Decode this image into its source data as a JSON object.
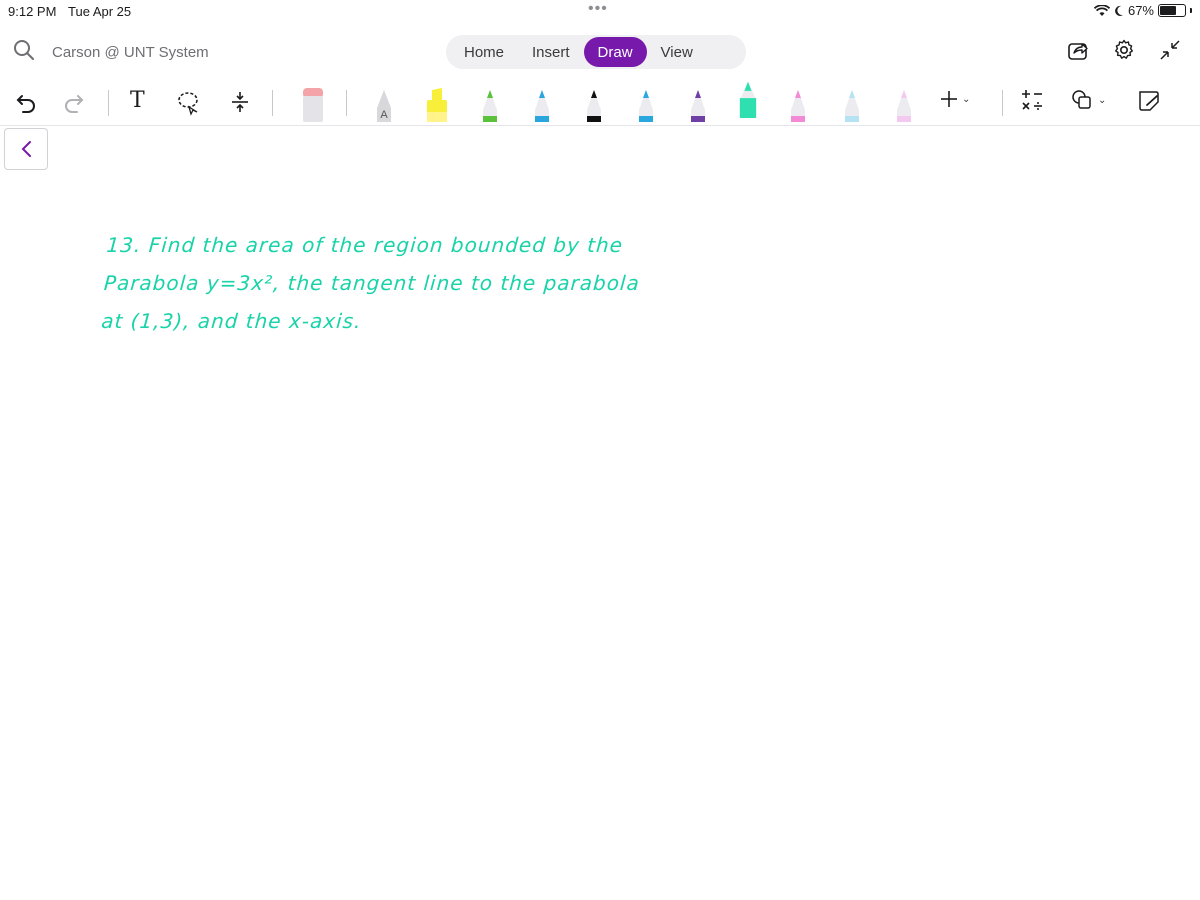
{
  "status": {
    "time": "9:12 PM",
    "date": "Tue Apr 25",
    "dots": "•••",
    "battery_label": "67%",
    "battery_level": 0.67
  },
  "header": {
    "account": "Carson @ UNT System",
    "tabs": [
      {
        "label": "Home",
        "active": false
      },
      {
        "label": "Insert",
        "active": false
      },
      {
        "label": "Draw",
        "active": true
      },
      {
        "label": "View",
        "active": false
      }
    ]
  },
  "toolbar": {
    "text_tool_label": "T",
    "pens": [
      {
        "name": "eraser",
        "color": "#f4a3a8"
      },
      {
        "name": "pen-a",
        "color": "#c9c9c9",
        "label": "A"
      },
      {
        "name": "highlighter-yellow",
        "color": "#f7ef3a"
      },
      {
        "name": "pen-green",
        "color": "#5dc23b"
      },
      {
        "name": "pen-blue",
        "color": "#2aa6df"
      },
      {
        "name": "pen-black",
        "color": "#111111"
      },
      {
        "name": "pen-lightblue",
        "color": "#29a8e0"
      },
      {
        "name": "pen-purple",
        "color": "#6f3fa6"
      },
      {
        "name": "marker-teal",
        "color": "#2ee0b0"
      },
      {
        "name": "pen-pink",
        "color": "#f28ad6"
      },
      {
        "name": "pen-paleblue",
        "color": "#b6e3f4"
      },
      {
        "name": "pen-lavender",
        "color": "#f3c9ef"
      }
    ]
  },
  "note": {
    "lines": [
      "13. Find the area of the region bounded by the",
      "Parabola y=3x², the tangent line to the parabola",
      "at (1,3), and the x-axis."
    ],
    "ink_color": "#19d3a8"
  }
}
